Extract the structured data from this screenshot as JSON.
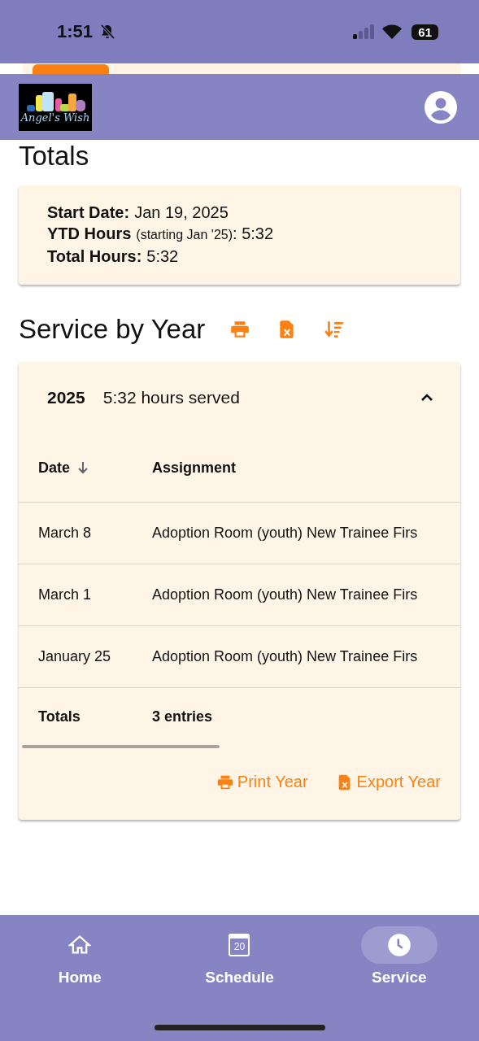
{
  "status_bar": {
    "time": "1:51",
    "battery": "61"
  },
  "header": {
    "logo_text": "Angel's Wish"
  },
  "totals": {
    "title": "Totals",
    "lines": [
      {
        "label": "Start Date:",
        "value": "Jan 19, 2025"
      },
      {
        "label": "YTD Hours",
        "note": "(starting Jan '25)",
        "value": ": 5:32"
      },
      {
        "label": "Total Hours:",
        "value": "5:32"
      }
    ]
  },
  "service": {
    "title": "Service by Year",
    "years": [
      {
        "year": "2025",
        "summary": "5:32 hours served",
        "expanded": true,
        "columns": [
          {
            "label": "Date",
            "sorted": true
          },
          {
            "label": "Assignment",
            "sorted": false
          }
        ],
        "rows": [
          {
            "date": "March 8",
            "assignment": "Adoption Room (youth) New Trainee Firs"
          },
          {
            "date": "March 1",
            "assignment": "Adoption Room (youth) New Trainee Firs"
          },
          {
            "date": "January 25",
            "assignment": "Adoption Room (youth) New Trainee Firs"
          }
        ],
        "footer": {
          "label": "Totals",
          "value": "3 entries"
        },
        "actions": [
          {
            "kind": "print",
            "label": "Print Year"
          },
          {
            "kind": "export",
            "label": "Export Year"
          }
        ]
      }
    ]
  },
  "nav": [
    {
      "kind": "home",
      "label": "Home",
      "selected": false
    },
    {
      "kind": "schedule",
      "label": "Schedule",
      "selected": false,
      "icon_text": "20"
    },
    {
      "kind": "service",
      "label": "Service",
      "selected": true
    }
  ]
}
